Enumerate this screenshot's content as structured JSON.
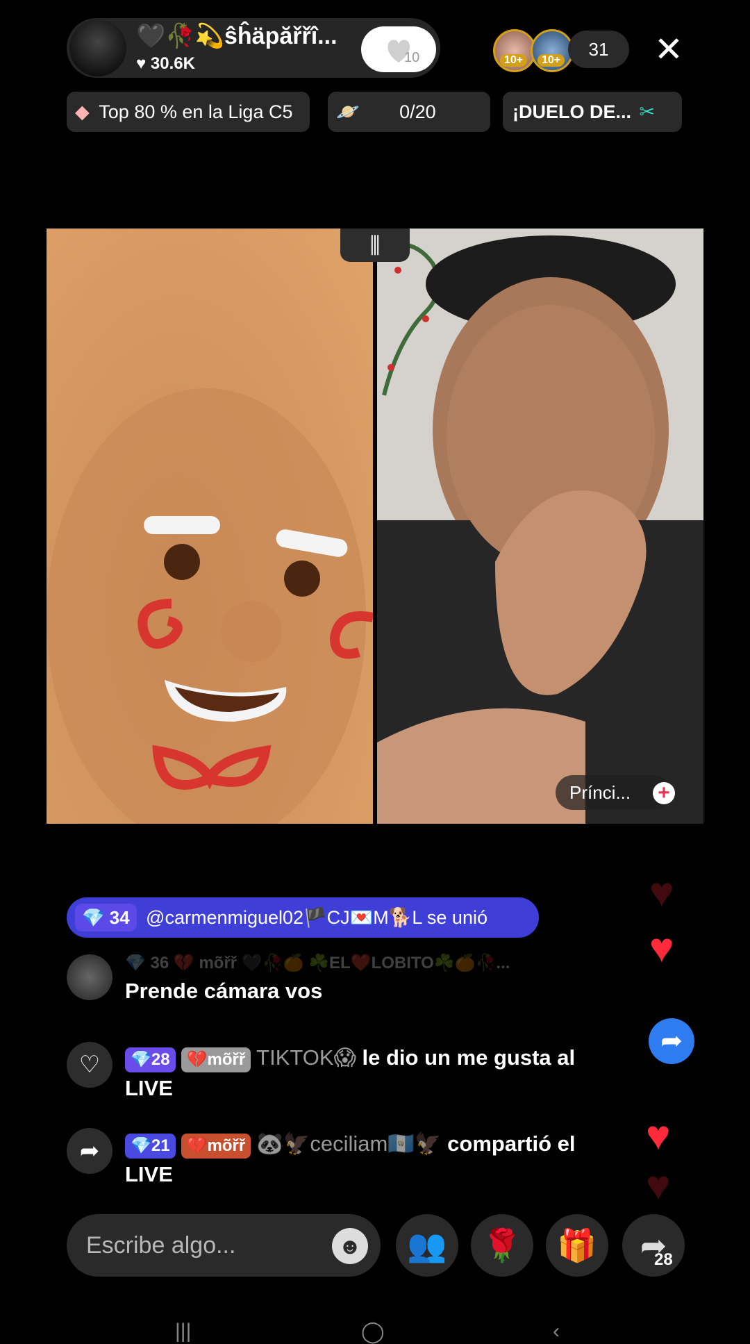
{
  "host": {
    "name": "🖤🥀💫ŝĥäpăřřî...",
    "likes": "♥ 30.6K",
    "follow_count": "10"
  },
  "viewers": {
    "badge_1": "10+",
    "badge_2": "10+",
    "count": "31"
  },
  "chips": {
    "league": "Top 80 % en la Liga C5",
    "goal": "0/20",
    "battle": "¡DUELO DE..."
  },
  "stream": {
    "right_tag": "Prínci...",
    "plus": "+"
  },
  "join_banner": {
    "level": "34",
    "text": "@carmenmiguel02🏴CJ💌M🐕L se unió"
  },
  "comments": [
    {
      "faded_header": "💎 36  💔 mõřř  🖤🥀🍊 ☘️EL❤️LOBITO☘️🍊🥀...",
      "text": "Prende cámara vos"
    },
    {
      "level": "28",
      "fan": "mõřř",
      "user": "TIKTOK😱",
      "text": "le dio un me gusta al",
      "text2": "LIVE"
    },
    {
      "level": "21",
      "fan": "mõřř",
      "user": "🐼🦅ceciliam🇬🇹🦅",
      "text": "compartió el",
      "text2": "LIVE"
    }
  ],
  "bottom": {
    "placeholder": "Escribe algo...",
    "share_count": "28"
  },
  "colors": {
    "accent": "#3f3fd8",
    "gem": "#6a4de8",
    "heart": "#ff2b3b",
    "gift": "#e6375a"
  }
}
